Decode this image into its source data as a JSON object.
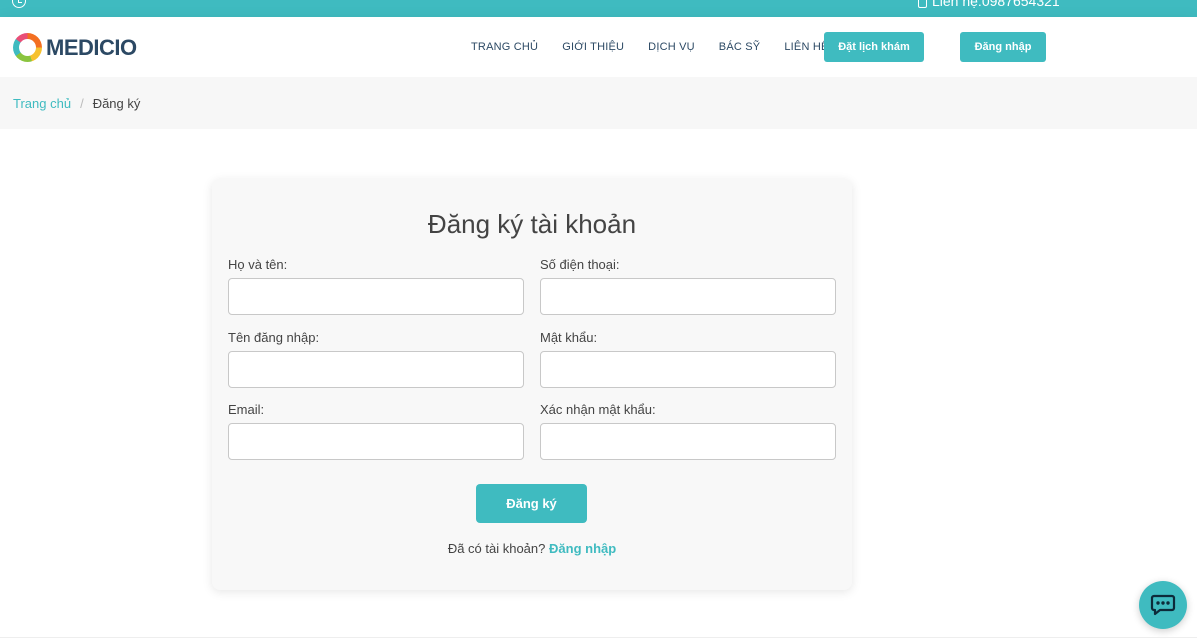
{
  "topbar": {
    "clock_icon": "clock-icon",
    "phone_icon": "phone-icon",
    "contact_text": "Liên hệ:0987654321"
  },
  "brand": {
    "name": "MEDICIO",
    "logo_icon": "logo-ring-icon"
  },
  "nav": {
    "items": [
      "TRANG CHỦ",
      "GIỚI THIỆU",
      "DỊCH VỤ",
      "BÁC SỸ",
      "LIÊN HỆ"
    ],
    "appointment_label": "Đặt lịch khám",
    "login_label": "Đăng nhập"
  },
  "breadcrumb": {
    "home": "Trang chủ",
    "separator": "/",
    "current": "Đăng ký"
  },
  "form": {
    "title": "Đăng ký tài khoản",
    "fullname_label": "Họ và tên:",
    "phone_label": "Số điện thoại:",
    "username_label": "Tên đăng nhập:",
    "password_label": "Mật khẩu:",
    "email_label": "Email:",
    "confirm_label": "Xác nhận mật khẩu:",
    "submit_label": "Đăng ký",
    "have_account_text": "Đã có tài khoản?",
    "login_link": "Đăng nhập"
  },
  "chat": {
    "icon": "chat-bubble-icon"
  },
  "colors": {
    "accent": "#3fbbc0",
    "text": "#444444",
    "nav_text": "#2c4964"
  }
}
